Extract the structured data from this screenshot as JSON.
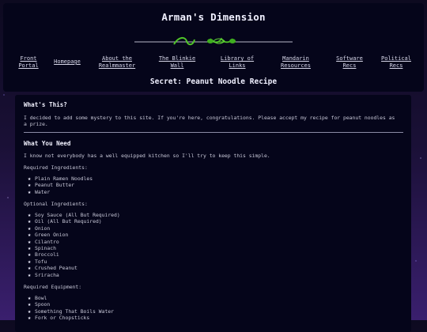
{
  "header": {
    "title": "Arman's Dimension",
    "subtitle": "Secret: Peanut Noodle Recipe",
    "nav": [
      "Front\nPortal",
      "Homepage",
      "About the\nRealmmaster",
      "The Blinkie\nWall",
      "Library of\nLinks",
      "Mandarin\nResources",
      "Software\nRecs",
      "Political\nRecs"
    ]
  },
  "main": {
    "whats_this": {
      "heading": "What's This?",
      "text": "I decided to add some mystery to this site. If you're here, congratulations. Please accept my recipe for peanut noodles as a prize."
    },
    "what_you_need": {
      "heading": "What You Need",
      "intro": "I know not everybody has a well equipped kitchen so I'll try to keep this simple.",
      "required_label": "Required Ingredients:",
      "required": [
        "Plain Ramen Noodles",
        "Peanut Butter",
        "Water"
      ],
      "optional_label": "Optional Ingredients:",
      "optional": [
        "Soy Sauce (All But Required)",
        "Oil (All But Required)",
        "Onion",
        "Green Onion",
        "Cilantro",
        "Spinach",
        "Broccoli",
        "Tofu",
        "Crushed Peanut",
        "Sriracha"
      ],
      "equipment_label": "Required Equipment:",
      "equipment": [
        "Bowl",
        "Spoon",
        "Something That Boils Water",
        "Fork or Chopsticks"
      ]
    }
  },
  "icons": {
    "bullet": "star-icon",
    "divider": "vine-divider-icon"
  },
  "colors": {
    "panel": "#05051a",
    "text": "#d8d8e6",
    "vine": "#4fc428",
    "background": "#1c1238"
  }
}
